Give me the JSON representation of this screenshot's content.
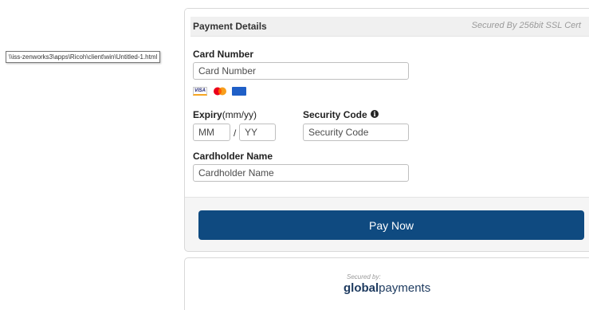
{
  "header": {
    "title": "Payment Details",
    "secured_text": "Secured By 256bit SSL Cert",
    "icon": "lock-icon"
  },
  "tooltip": {
    "text": "\\\\iss-zenworks3\\apps\\Ricoh\\client\\win\\Untitled-1.html"
  },
  "card_number": {
    "label": "Card Number",
    "placeholder": "Card Number"
  },
  "brands": [
    {
      "name": "visa-icon",
      "label": "VISA"
    },
    {
      "name": "mastercard-icon"
    },
    {
      "name": "maestro-icon"
    }
  ],
  "expiry": {
    "label": "Expiry",
    "hint": "(mm/yy)",
    "month_placeholder": "MM",
    "separator": "/",
    "year_placeholder": "YY"
  },
  "security_code": {
    "label": "Security Code",
    "placeholder": "Security Code",
    "icon": "info-icon"
  },
  "cardholder": {
    "label": "Cardholder Name",
    "placeholder": "Cardholder Name"
  },
  "pay_button": {
    "label": "Pay Now"
  },
  "footer": {
    "secured_by": "Secured by:",
    "brand_bold": "global",
    "brand_light": "payments"
  },
  "colors": {
    "button": "#0f4a80",
    "logo": "#1d3a5f"
  }
}
